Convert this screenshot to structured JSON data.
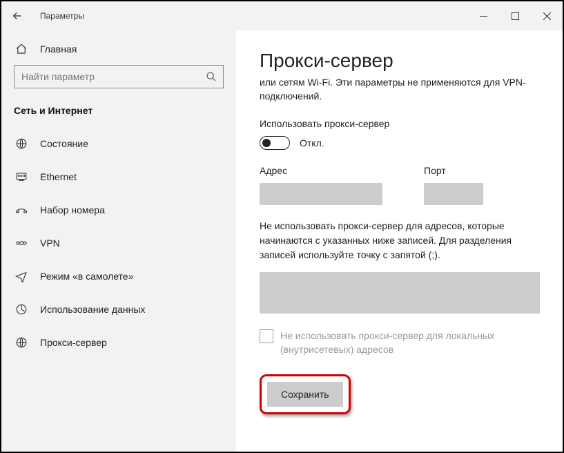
{
  "window": {
    "title": "Параметры"
  },
  "sidebar": {
    "home": "Главная",
    "search_placeholder": "Найти параметр",
    "section": "Сеть и Интернет",
    "items": [
      {
        "label": "Состояние"
      },
      {
        "label": "Ethernet"
      },
      {
        "label": "Набор номера"
      },
      {
        "label": "VPN"
      },
      {
        "label": "Режим «в самолете»"
      },
      {
        "label": "Использование данных"
      },
      {
        "label": "Прокси-сервер"
      }
    ]
  },
  "content": {
    "title": "Прокси-сервер",
    "description": "или сетям Wi-Fi. Эти параметры не применяются для VPN-подключений.",
    "use_proxy_label": "Использовать прокси-сервер",
    "toggle_state": "Откл.",
    "address_label": "Адрес",
    "address_value": "",
    "port_label": "Порт",
    "port_value": "",
    "bypass_description": "Не использовать прокси-сервер для адресов, которые начинаются с указанных ниже записей. Для разделения записей используйте точку с запятой (;).",
    "bypass_value": "",
    "checkbox_label": "Не использовать прокси-сервер для локальных (внутрисетевых) адресов",
    "save_label": "Сохранить"
  }
}
